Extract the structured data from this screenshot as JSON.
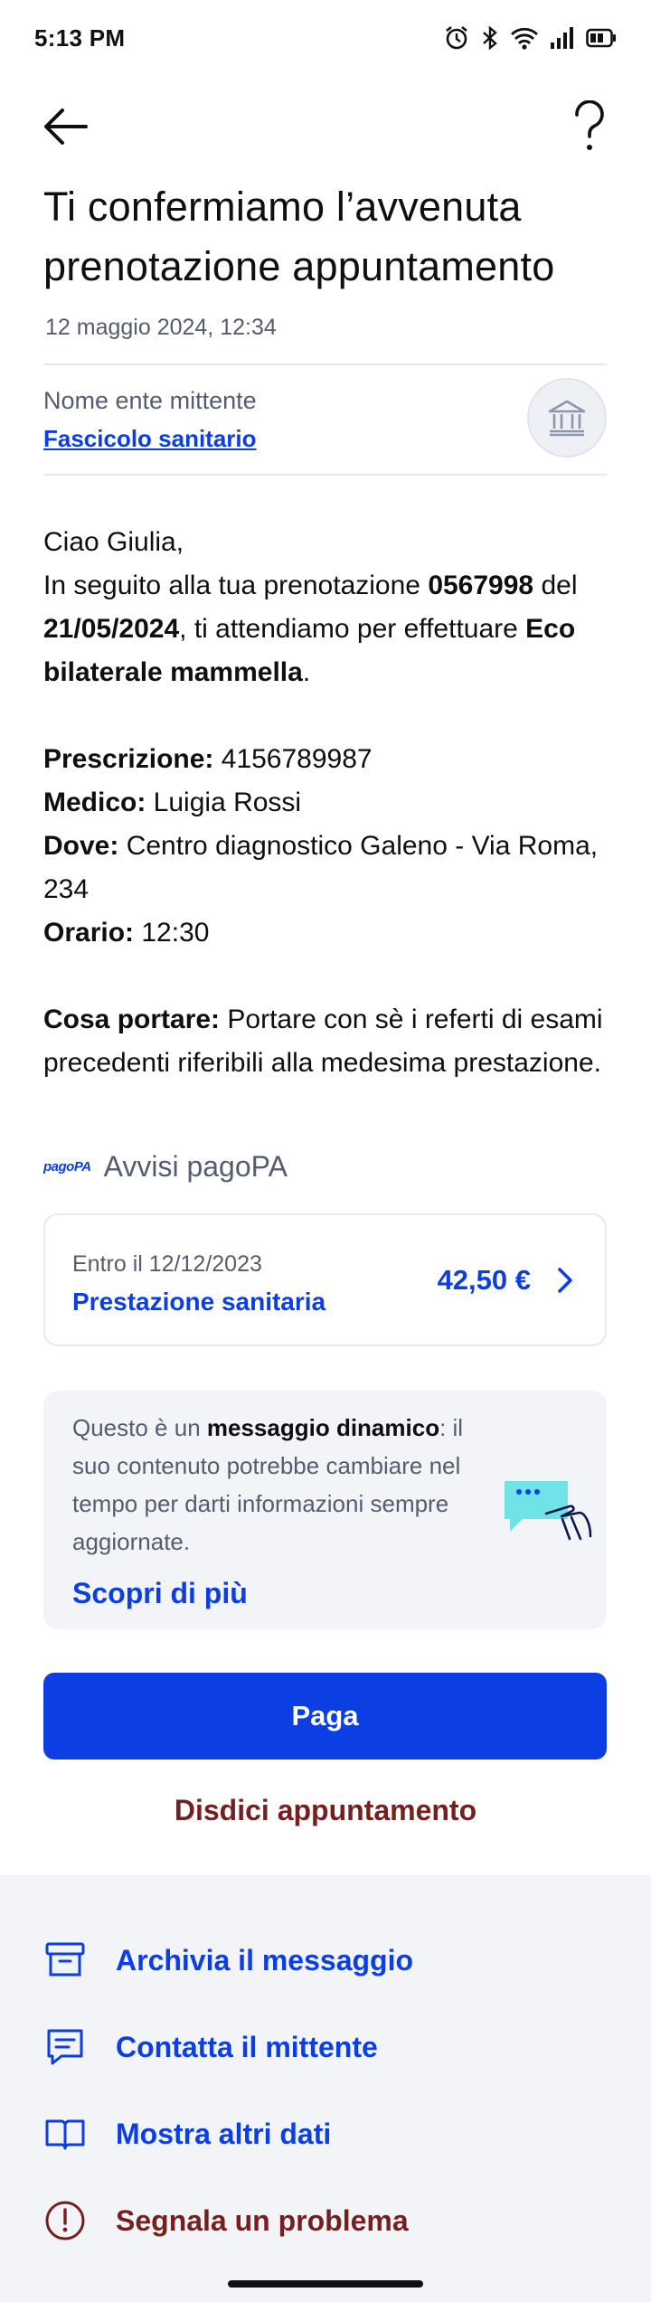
{
  "status_bar": {
    "time": "5:13 PM"
  },
  "nav": {
    "back_icon": "arrow-left-icon",
    "help_icon": "question-mark-icon"
  },
  "message": {
    "title": "Ti confermiamo l’avvenuta prenotazione appuntamento",
    "date": "12 maggio 2024, 12:34",
    "sender_label": "Nome ente mittente",
    "sender_link": "Fascicolo sanitario",
    "greeting": "Ciao Giulia,",
    "intro_1": "In seguito alla tua prenotazione ",
    "booking_code": "0567998",
    "intro_2": " del ",
    "booking_date": "21/05/2024",
    "intro_3": ", ti attendiamo per effettuare ",
    "exam": "Eco bilaterale mammella",
    "intro_4": ".",
    "details": {
      "prescription_label": "Prescrizione:",
      "prescription_value": " 4156789987",
      "doctor_label": "Medico:",
      "doctor_value": " Luigia Rossi",
      "where_label": "Dove:",
      "where_value": " Centro diagnostico Galeno - Via Roma, 234",
      "time_label": "Orario:",
      "time_value": " 12:30"
    },
    "bring_label": "Cosa portare:",
    "bring_value": " Portare con sè i referti di esami precedenti riferibili alla medesima prestazione."
  },
  "pagopa": {
    "logo_text": "pagoPA",
    "section_title": "Avvisi pagoPA",
    "notice": {
      "due": "Entro il 12/12/2023",
      "name": "Prestazione sanitaria",
      "amount": "42,50 €"
    }
  },
  "dynamic_message": {
    "text_1": "Questo è un ",
    "text_bold": "messaggio dinamico",
    "text_2": ": il suo contenuto potrebbe cambiare nel tempo per darti informazioni sempre aggiornate.",
    "link": "Scopri di più"
  },
  "buttons": {
    "pay": "Paga",
    "cancel": "Disdici appuntamento"
  },
  "actions": [
    {
      "label": "Archivia il messaggio",
      "icon": "archive-icon"
    },
    {
      "label": "Contatta il mittente",
      "icon": "chat-icon"
    },
    {
      "label": "Mostra altri dati",
      "icon": "book-icon"
    },
    {
      "label": "Segnala un problema",
      "icon": "alert-icon"
    }
  ],
  "colors": {
    "primary": "#0b3ee3",
    "danger": "#761f1f",
    "muted": "#555c70",
    "surface": "#f3f4f8"
  }
}
